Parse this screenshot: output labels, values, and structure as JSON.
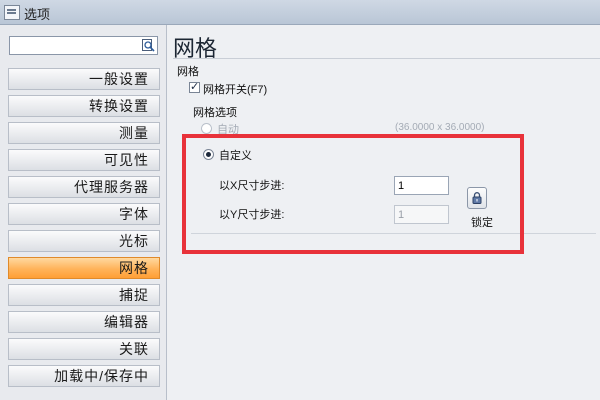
{
  "window": {
    "title": "选项"
  },
  "sidebar": {
    "search": {
      "value": "",
      "placeholder": ""
    },
    "items": [
      {
        "label": "一般设置"
      },
      {
        "label": "转换设置"
      },
      {
        "label": "测量"
      },
      {
        "label": "可见性"
      },
      {
        "label": "代理服务器"
      },
      {
        "label": "字体"
      },
      {
        "label": "光标"
      },
      {
        "label": "网格",
        "active": true
      },
      {
        "label": "捕捉"
      },
      {
        "label": "编辑器"
      },
      {
        "label": "关联"
      },
      {
        "label": "加载中/保存中"
      }
    ]
  },
  "main": {
    "title": "网格",
    "section_label": "网格",
    "grid_toggle": {
      "label": "网格开关(F7)",
      "checked": true
    },
    "options_group_label": "网格选项",
    "auto_option": {
      "label": "自动",
      "value": "(36.0000 x 36.0000)",
      "selected": false
    },
    "custom_option": {
      "label": "自定义",
      "selected": true
    },
    "x_step": {
      "label": "以X尺寸步进:",
      "value": "1"
    },
    "y_step": {
      "label": "以Y尺寸步进:",
      "value": "1",
      "disabled": true
    },
    "lock": {
      "label": "锁定",
      "icon": "padlock-icon"
    }
  },
  "colors": {
    "active_item": "#ffb35a",
    "highlight_border": "#e8323a"
  }
}
